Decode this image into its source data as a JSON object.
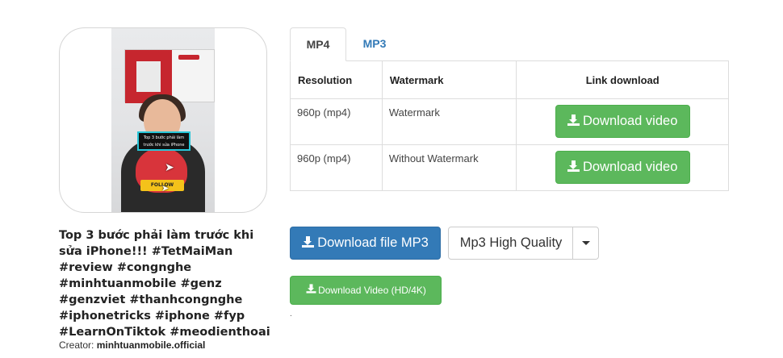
{
  "video": {
    "title": "Top 3 bước phải làm trước khi sửa iPhone!!! #TetMaiMan #review #congnghe #minhtuanmobile #genz #genzviet #thanhcongnghe #iphonetricks #iphone #fyp #LearnOnTiktok #meodienthoai",
    "creator_label": "Creator:",
    "creator_name": "minhtuanmobile.official",
    "thumbnail_caption": "Top 3 bước phải làm trước khi sửa iPhone",
    "thumbnail_follow": "FOLLOW"
  },
  "tabs": [
    {
      "label": "MP4",
      "active": true
    },
    {
      "label": "MP3",
      "active": false
    }
  ],
  "table": {
    "headers": [
      "Resolution",
      "Watermark",
      "Link download"
    ],
    "rows": [
      {
        "resolution": "960p (mp4)",
        "watermark": "Watermark",
        "button": "Download video"
      },
      {
        "resolution": "960p (mp4)",
        "watermark": "Without Watermark",
        "button": "Download video"
      }
    ]
  },
  "actions": {
    "mp3_button": "Download file MP3",
    "quality_selected": "Mp3 High Quality",
    "hd_button": "Download Video (HD/4K)",
    "dot": "."
  },
  "colors": {
    "primary": "#337ab7",
    "success": "#5cb85c",
    "tab_link": "#337ab7"
  },
  "icons": {
    "download": "download-icon",
    "caret": "caret-down-icon"
  }
}
